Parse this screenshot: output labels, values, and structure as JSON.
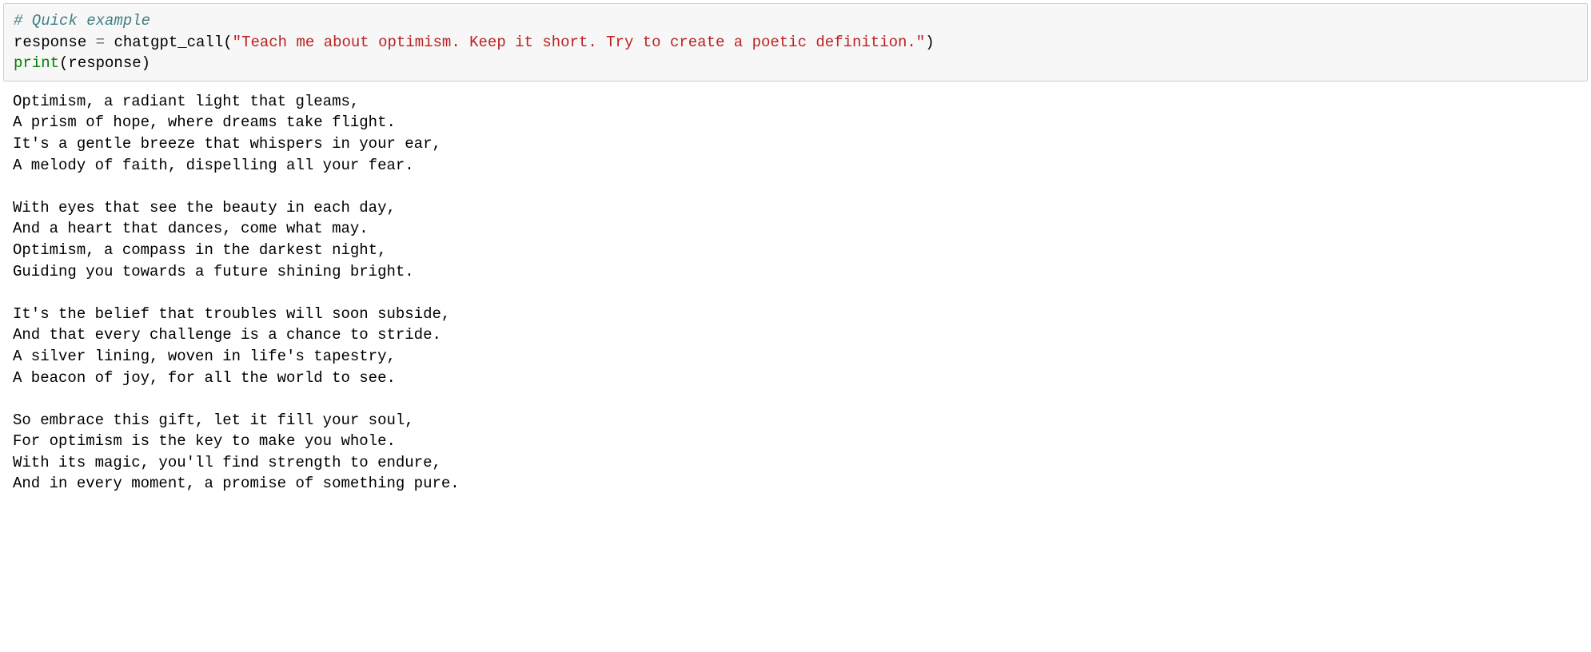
{
  "code": {
    "line1_comment": "# Quick example",
    "line2_var": "response",
    "line2_eq": " = ",
    "line2_func": "chatgpt_call(",
    "line2_string": "\"Teach me about optimism. Keep it short. Try to create a poetic definition.\"",
    "line2_close": ")",
    "line3_func": "print",
    "line3_open": "(",
    "line3_arg": "response",
    "line3_close": ")"
  },
  "output": "Optimism, a radiant light that gleams,\nA prism of hope, where dreams take flight.\nIt's a gentle breeze that whispers in your ear,\nA melody of faith, dispelling all your fear.\n\nWith eyes that see the beauty in each day,\nAnd a heart that dances, come what may.\nOptimism, a compass in the darkest night,\nGuiding you towards a future shining bright.\n\nIt's the belief that troubles will soon subside,\nAnd that every challenge is a chance to stride.\nA silver lining, woven in life's tapestry,\nA beacon of joy, for all the world to see.\n\nSo embrace this gift, let it fill your soul,\nFor optimism is the key to make you whole.\nWith its magic, you'll find strength to endure,\nAnd in every moment, a promise of something pure."
}
